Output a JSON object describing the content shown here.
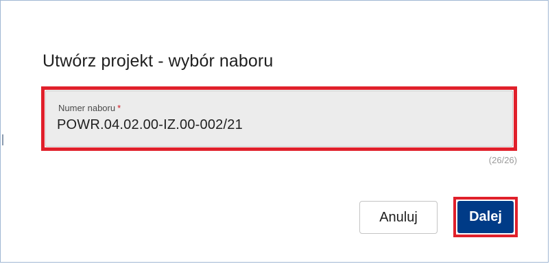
{
  "dialog": {
    "title": "Utwórz projekt - wybór naboru",
    "field": {
      "label": "Numer naboru",
      "required_mark": "*",
      "value": "POWR.04.02.00-IZ.00-002/21",
      "counter": "(26/26)"
    },
    "buttons": {
      "cancel_label": "Anuluj",
      "next_label": "Dalej"
    }
  },
  "colors": {
    "highlight": "#e0202b",
    "primary_button": "#003b87",
    "field_background": "#ececec"
  }
}
